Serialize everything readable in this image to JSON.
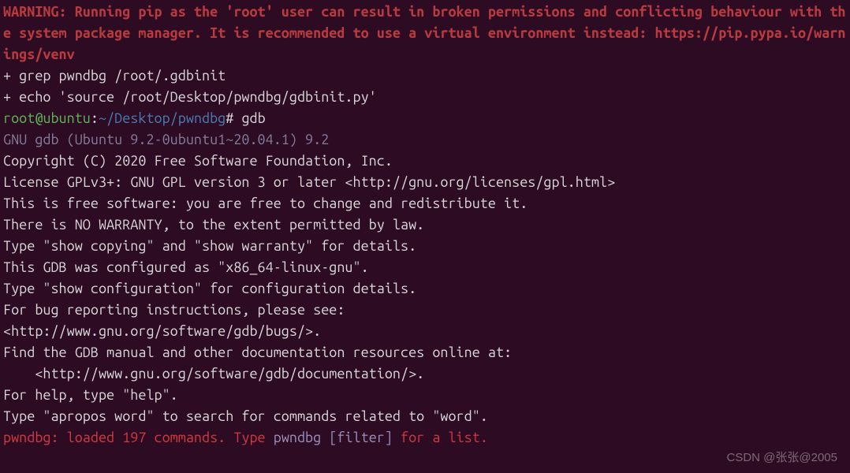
{
  "warning": "WARNING: Running pip as the 'root' user can result in broken permissions and conflicting behaviour with the system package manager. It is recommended to use a virtual environment instead: https://pip.pypa.io/warnings/venv",
  "cmd_grep": "+ grep pwndbg /root/.gdbinit",
  "cmd_echo": "+ echo 'source /root/Desktop/pwndbg/gdbinit.py'",
  "prompt": {
    "user_host": "root@ubuntu",
    "sep": ":",
    "path": "~/Desktop/pwndbg",
    "hash": "#",
    "command": " gdb"
  },
  "gdb": {
    "banner": "GNU gdb (Ubuntu 9.2-0ubuntu1~20.04.1) 9.2",
    "copyright": "Copyright (C) 2020 Free Software Foundation, Inc.",
    "license": "License GPLv3+: GNU GPL version 3 or later <http://gnu.org/licenses/gpl.html>",
    "free1": "This is free software: you are free to change and redistribute it.",
    "free2": "There is NO WARRANTY, to the extent permitted by law.",
    "show_copy": "Type \"show copying\" and \"show warranty\" for details.",
    "configured": "This GDB was configured as \"x86_64-linux-gnu\".",
    "show_conf": "Type \"show configuration\" for configuration details.",
    "bugreport1": "For bug reporting instructions, please see:",
    "bugreport2": "<http://www.gnu.org/software/gdb/bugs/>.",
    "manual1": "Find the GDB manual and other documentation resources online at:",
    "manual2": "    <http://www.gnu.org/software/gdb/documentation/>.",
    "blank": "",
    "help1": "For help, type \"help\".",
    "help2": "Type \"apropos word\" to search for commands related to \"word\"."
  },
  "pwndbg": {
    "prefix": "pwndbg:",
    "loaded": " loaded 197 commands. Type ",
    "filter": "pwndbg [filter]",
    "suffix": " for a list."
  },
  "watermark": "CSDN @张张@2005"
}
